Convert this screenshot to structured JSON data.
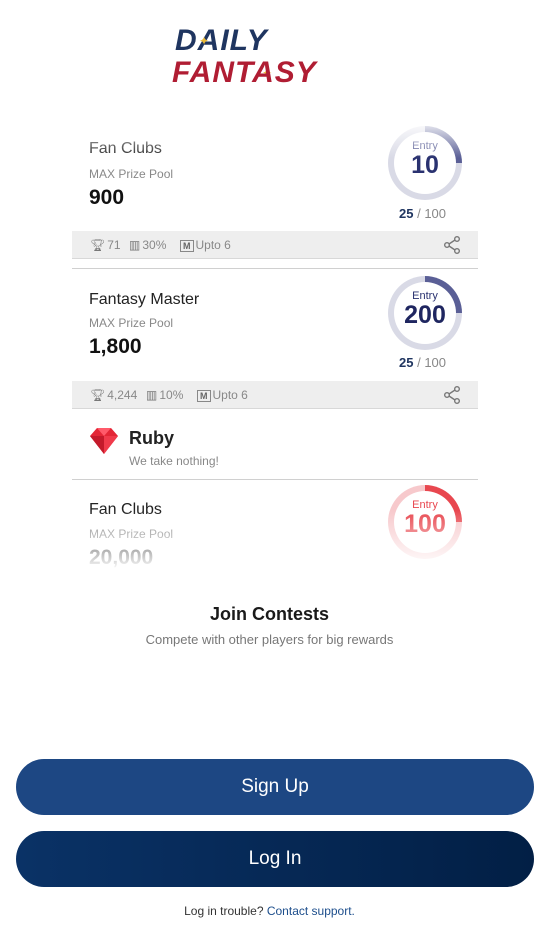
{
  "logo": {
    "line1": "DAILY",
    "line2": "FANTASY"
  },
  "contests": [
    {
      "name": "Fan Clubs",
      "pool_label": "MAX Prize Pool",
      "pool_value": "900",
      "entry_label": "Entry",
      "entry_value": "10",
      "slots_filled": "25",
      "slots_total": "/ 100",
      "stats": {
        "winners": "71",
        "percent": "30%",
        "upto": "Upto 6"
      },
      "ring_color": "#5a5f96",
      "fill_fraction": 0.25
    },
    {
      "name": "Fantasy Master",
      "pool_label": "MAX Prize Pool",
      "pool_value": "1,800",
      "entry_label": "Entry",
      "entry_value": "200",
      "slots_filled": "25",
      "slots_total": "/ 100",
      "stats": {
        "winners": "4,244",
        "percent": "10%",
        "upto": "Upto 6"
      },
      "ring_color": "#5a5f96",
      "fill_fraction": 0.25
    },
    {
      "name": "Fan Clubs",
      "pool_label": "MAX Prize Pool",
      "pool_value": "20,000",
      "entry_label": "Entry",
      "entry_value": "100",
      "ring_color": "#e8474f",
      "fill_fraction": 0.25
    }
  ],
  "ruby": {
    "name": "Ruby",
    "tagline": "We take nothing!"
  },
  "join": {
    "title": "Join Contests",
    "subtitle": "Compete with other players for big rewards"
  },
  "buttons": {
    "signup": "Sign Up",
    "login": "Log In"
  },
  "footer": {
    "text": "Log in trouble?",
    "link": "Contact support."
  },
  "colors": {
    "primary": "#1d4783",
    "dark": "#021f45",
    "brand_red": "#b01d33",
    "ruby": "#e32636"
  }
}
